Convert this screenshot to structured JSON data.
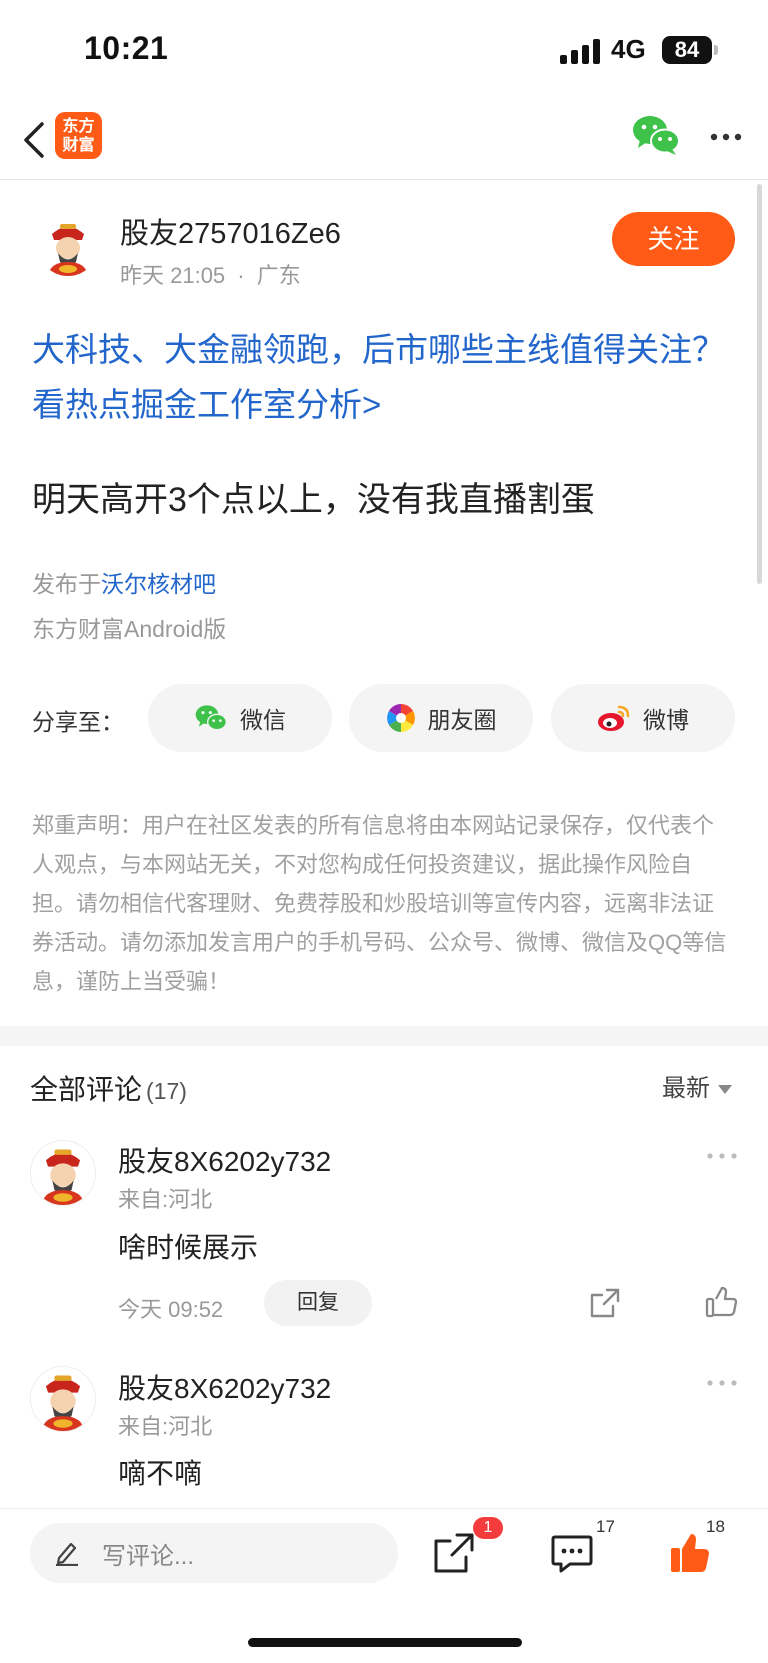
{
  "status_bar": {
    "time": "10:21",
    "network": "4G",
    "battery": "84"
  },
  "nav": {
    "logo_line1": "东方",
    "logo_line2": "财富"
  },
  "post": {
    "author": "股友2757016Ze6",
    "time": "昨天 21:05",
    "separator": "·",
    "location": "广东",
    "follow_label": "关注",
    "promo_link": "大科技、大金融领跑，后市哪些主线值得关注？看热点掘金工作室分析>",
    "body": "明天高开3个点以上，没有我直播割蛋",
    "source_prefix": "发布于",
    "forum": "沃尔核材吧",
    "client": "东方财富Android版"
  },
  "share": {
    "label": "分享至：",
    "options": [
      {
        "label": "微信",
        "icon": "wechat-icon"
      },
      {
        "label": "朋友圈",
        "icon": "moments-icon"
      },
      {
        "label": "微博",
        "icon": "weibo-icon"
      }
    ]
  },
  "disclaimer": "郑重声明：用户在社区发表的所有信息将由本网站记录保存，仅代表个人观点，与本网站无关，不对您构成任何投资建议，据此操作风险自担。请勿相信代客理财、免费荐股和炒股培训等宣传内容，远离非法证券活动。请勿添加发言用户的手机号码、公众号、微博、微信及QQ等信息，谨防上当受骗！",
  "comments": {
    "title": "全部评论",
    "count": "(17)",
    "sort_label": "最新",
    "items": [
      {
        "author": "股友8X6202y732",
        "location": "来自:河北",
        "text": "啥时候展示",
        "time": "今天 09:52",
        "reply_label": "回复"
      },
      {
        "author": "股友8X6202y732",
        "location": "来自:河北",
        "text": "嘀不嘀"
      }
    ]
  },
  "bottom_bar": {
    "input_placeholder": "写评论...",
    "share_badge": "1",
    "comment_count": "17",
    "like_count": "18"
  },
  "colors": {
    "accent": "#ff5a16",
    "link": "#2266cc",
    "like": "#ff5a16",
    "badge": "#f53c3c"
  }
}
